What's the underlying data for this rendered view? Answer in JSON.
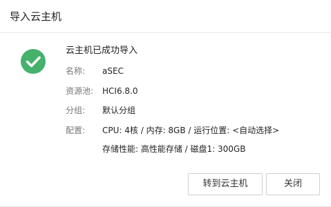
{
  "dialog": {
    "title": "导入云主机"
  },
  "status": {
    "icon": "check-circle-icon",
    "icon_color": "#45b16b",
    "message": "云主机已成功导入"
  },
  "details": {
    "name_label": "名称:",
    "name_value": "aSEC",
    "pool_label": "资源池:",
    "pool_value": "HCI6.8.0",
    "group_label": "分组:",
    "group_value": "默认分组",
    "config_label": "配置:",
    "config_line1": "CPU: 4核 / 内存: 8GB / 运行位置: <自动选择>",
    "config_line2": "存储性能: 高性能存储 / 磁盘1: 300GB"
  },
  "buttons": {
    "goto_label": "转到云主机",
    "close_label": "关闭"
  }
}
